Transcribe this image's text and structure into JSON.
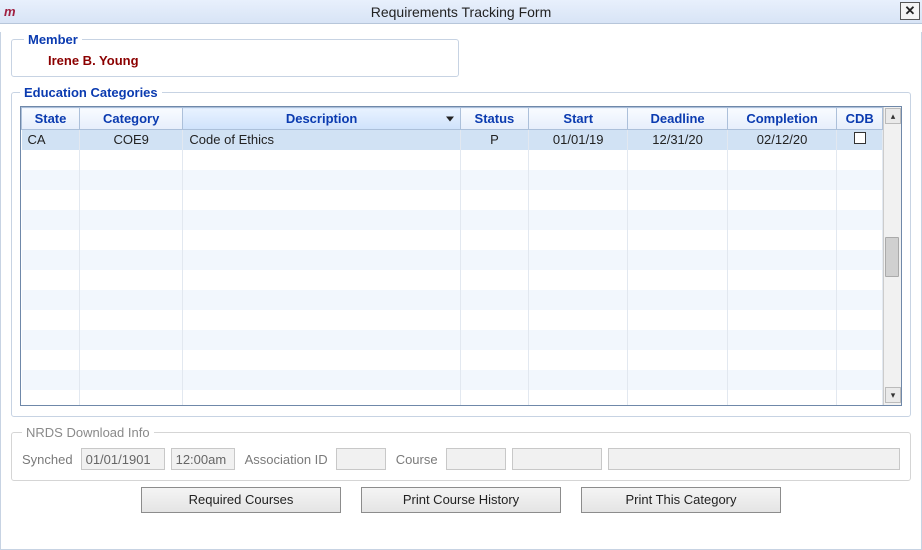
{
  "window": {
    "title": "Requirements Tracking Form"
  },
  "member": {
    "legend": "Member",
    "name": "Irene B. Young"
  },
  "education": {
    "legend": "Education Categories",
    "columns": {
      "state": "State",
      "category": "Category",
      "description": "Description",
      "status": "Status",
      "start": "Start",
      "deadline": "Deadline",
      "completion": "Completion",
      "cdb": "CDB"
    },
    "rows": [
      {
        "state": "CA",
        "category": "COE9",
        "description": "Code of Ethics",
        "status": "P",
        "start": "01/01/19",
        "deadline": "12/31/20",
        "completion": "02/12/20",
        "cdb": false
      }
    ]
  },
  "nrds": {
    "legend": "NRDS Download Info",
    "labels": {
      "synched": "Synched",
      "association_id": "Association ID",
      "course": "Course"
    },
    "synched_date": "01/01/1901",
    "synched_time": "12:00am",
    "association_id": "",
    "course_a": "",
    "course_b": "",
    "course_c": ""
  },
  "buttons": {
    "required_courses": "Required Courses",
    "print_history": "Print Course History",
    "print_category": "Print This Category"
  }
}
